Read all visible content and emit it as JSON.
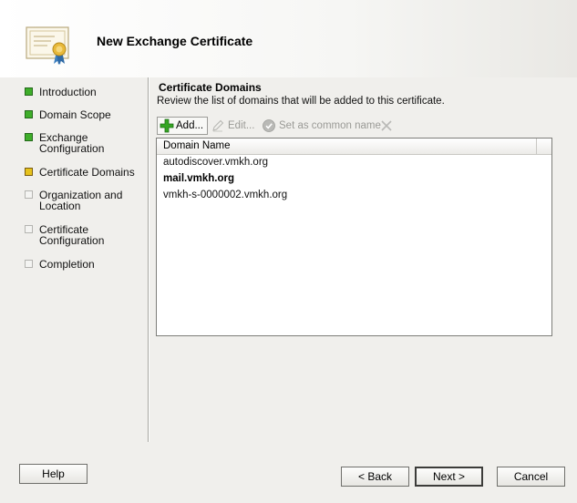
{
  "wizard": {
    "title": "New Exchange Certificate"
  },
  "steps": [
    {
      "label": "Introduction",
      "state": "done"
    },
    {
      "label": "Domain Scope",
      "state": "done"
    },
    {
      "label": "Exchange Configuration",
      "state": "done"
    },
    {
      "label": "Certificate Domains",
      "state": "current"
    },
    {
      "label": "Organization and Location",
      "state": "pending"
    },
    {
      "label": "Certificate Configuration",
      "state": "pending"
    },
    {
      "label": "Completion",
      "state": "pending"
    }
  ],
  "content": {
    "title": "Certificate Domains",
    "description": "Review the list of domains that will be added to this certificate."
  },
  "toolbar": {
    "add_label": "Add...",
    "edit_label": "Edit...",
    "common_name_label": "Set as common name"
  },
  "list": {
    "column_header": "Domain Name",
    "rows": [
      {
        "domain": "autodiscover.vmkh.org",
        "common": false
      },
      {
        "domain": "mail.vmkh.org",
        "common": true
      },
      {
        "domain": "vmkh-s-0000002.vmkh.org",
        "common": false
      }
    ]
  },
  "buttons": {
    "help": "Help",
    "back": "< Back",
    "next": "Next >",
    "cancel": "Cancel"
  },
  "colors": {
    "step_done": "#3fae2a",
    "step_current": "#e6c21c",
    "step_pending": "#f4f4f2"
  }
}
